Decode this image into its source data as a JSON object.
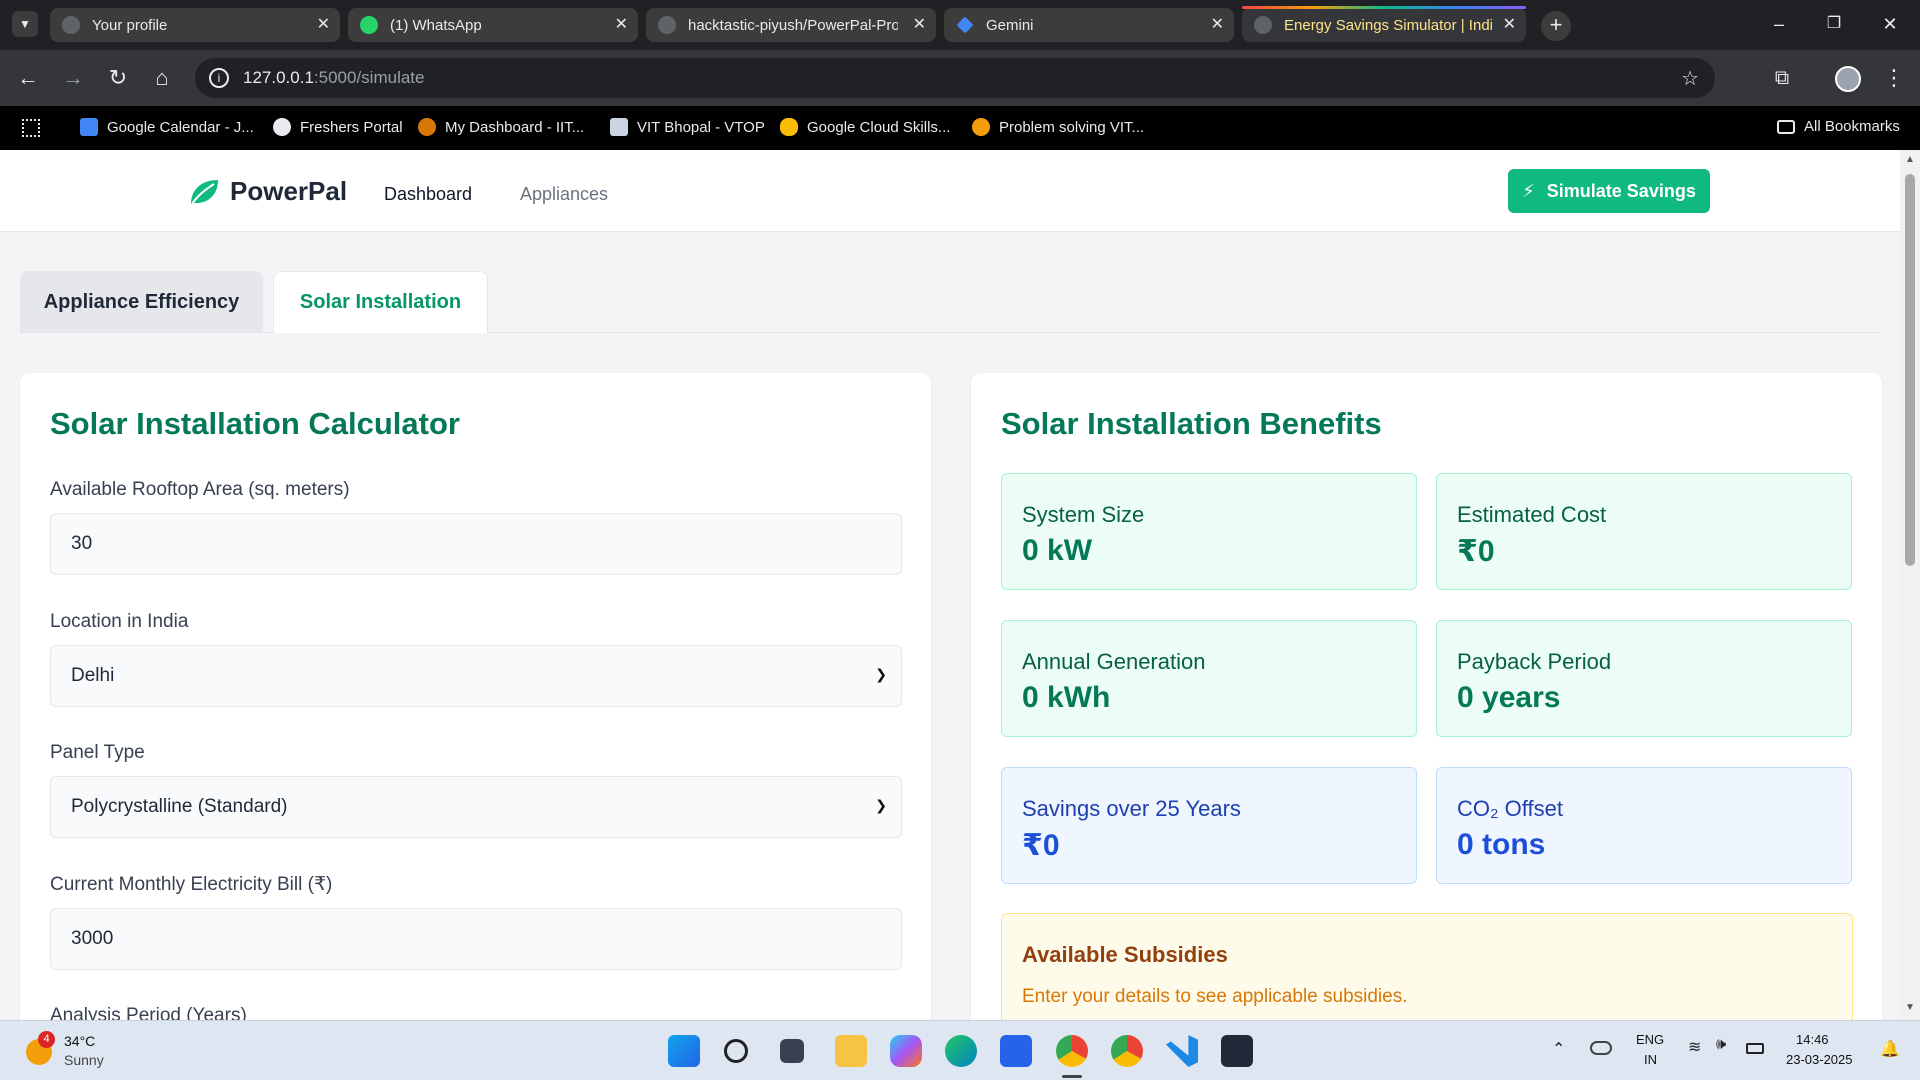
{
  "browser": {
    "tabs": [
      {
        "label": "Your profile",
        "icon": "github-icon"
      },
      {
        "label": "(1) WhatsApp",
        "icon": "whatsapp-icon"
      },
      {
        "label": "hacktastic-piyush/PowerPal-Pro",
        "icon": "github-icon"
      },
      {
        "label": "Gemini",
        "icon": "gemini-icon"
      },
      {
        "label": "Energy Savings Simulator | Indi",
        "icon": "globe-icon",
        "active": true
      }
    ],
    "url_host": "127.0.0.1",
    "url_path": ":5000/simulate",
    "bookmarks": [
      {
        "label": "Google Calendar - J...",
        "icon": "calendar-icon"
      },
      {
        "label": "Freshers Portal",
        "icon": "globe-icon"
      },
      {
        "label": "My Dashboard - IIT...",
        "icon": "dashboard-icon"
      },
      {
        "label": "VIT Bhopal - VTOP",
        "icon": "vit-icon"
      },
      {
        "label": "Google Cloud Skills...",
        "icon": "cloud-icon"
      },
      {
        "label": "Problem solving VIT...",
        "icon": "coursera-icon"
      }
    ],
    "all_bookmarks": "All Bookmarks"
  },
  "header": {
    "brand": "PowerPal",
    "nav": [
      "Dashboard",
      "Appliances"
    ],
    "cta": "Simulate Savings"
  },
  "tabs": [
    "Appliance Efficiency",
    "Solar Installation"
  ],
  "calculator": {
    "title": "Solar Installation Calculator",
    "fields": [
      {
        "label": "Available Rooftop Area (sq. meters)",
        "value": "30",
        "type": "input"
      },
      {
        "label": "Location in India",
        "value": "Delhi",
        "type": "select"
      },
      {
        "label": "Panel Type",
        "value": "Polycrystalline (Standard)",
        "type": "select"
      },
      {
        "label": "Current Monthly Electricity Bill (₹)",
        "value": "3000",
        "type": "input"
      },
      {
        "label": "Analysis Period (Years)",
        "value": "",
        "type": "input"
      }
    ]
  },
  "benefits": {
    "title": "Solar Installation Benefits",
    "stats": [
      {
        "label": "System Size",
        "value": "0 kW",
        "tone": "green"
      },
      {
        "label": "Estimated Cost",
        "value": "₹0",
        "tone": "green"
      },
      {
        "label": "Annual Generation",
        "value": "0 kWh",
        "tone": "green"
      },
      {
        "label": "Payback Period",
        "value": "0 years",
        "tone": "green"
      },
      {
        "label": "Savings over 25 Years",
        "value": "₹0",
        "tone": "blue"
      },
      {
        "label": "CO₂ Offset",
        "value": "0 tons",
        "tone": "blue"
      }
    ],
    "subsidies": {
      "title": "Available Subsidies",
      "text": "Enter your details to see applicable subsidies."
    }
  },
  "taskbar": {
    "weather_temp": "34°C",
    "weather_desc": "Sunny",
    "weather_badge": "4",
    "lang": "ENG",
    "region": "IN",
    "time": "14:46",
    "date": "23-03-2025"
  }
}
